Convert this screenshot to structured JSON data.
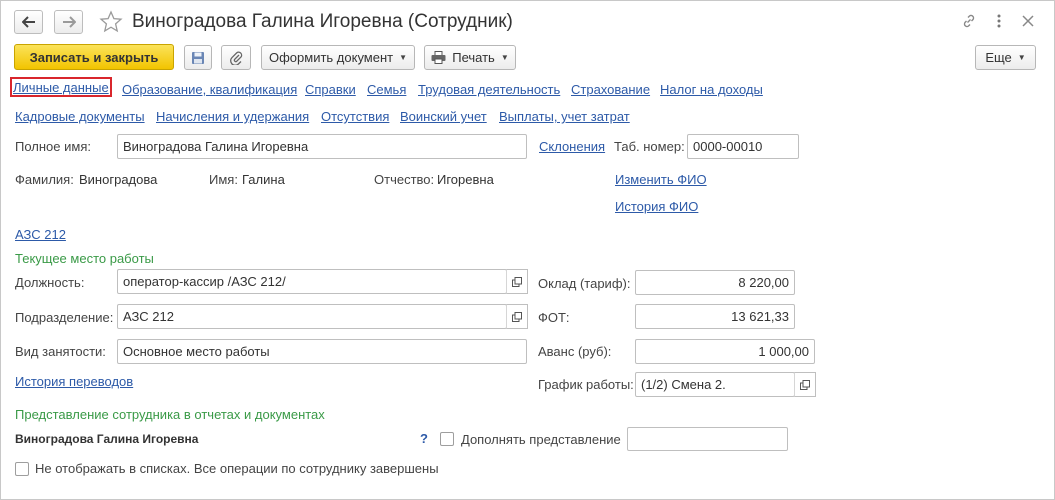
{
  "window": {
    "title": "Виноградова Галина Игоревна (Сотрудник)",
    "icons": [
      "arrow-left-icon",
      "arrow-right-icon",
      "star-icon",
      "link-icon",
      "more-vertical-icon",
      "close-icon"
    ]
  },
  "toolbar": {
    "save_close_label": "Записать и закрыть",
    "create_document_label": "Оформить документ",
    "print_label": "Печать",
    "more_label": "Еще"
  },
  "nav": {
    "row1": [
      "Личные данные",
      "Образование, квалификация",
      "Справки",
      "Семья",
      "Трудовая деятельность",
      "Страхование",
      "Налог на доходы"
    ],
    "row2": [
      "Кадровые документы",
      "Начисления и удержания",
      "Отсутствия",
      "Воинский учет",
      "Выплаты, учет затрат"
    ],
    "active": "Личные данные"
  },
  "person": {
    "full_name_label": "Полное имя:",
    "full_name_value": "Виноградова Галина Игоревна",
    "declensions_link": "Склонения",
    "tab_number_label": "Таб. номер:",
    "tab_number_value": "0000-00010",
    "surname_label": "Фамилия:",
    "surname_value": "Виноградова",
    "name_label": "Имя:",
    "name_value": "Галина",
    "patronymic_label": "Отчество:",
    "patronymic_value": "Игоревна",
    "change_name_link": "Изменить ФИО",
    "name_history_link": "История ФИО"
  },
  "organization": {
    "link": "АЗС 212"
  },
  "workplace": {
    "section_title": "Текущее место работы",
    "position_label": "Должность:",
    "position_value": "оператор-кассир /АЗС 212/",
    "department_label": "Подразделение:",
    "department_value": "АЗС 212",
    "employment_label": "Вид занятости:",
    "employment_value": "Основное место работы",
    "transfer_history_link": "История переводов",
    "salary_label": "Оклад (тариф):",
    "salary_value": "8 220,00",
    "fot_label": "ФОТ:",
    "fot_value": "13 621,33",
    "advance_label": "Аванс (руб):",
    "advance_value": "1 000,00",
    "schedule_label": "График работы:",
    "schedule_value": "(1/2)  Смена 2."
  },
  "representation": {
    "section_title": "Представление сотрудника в отчетах и документах",
    "value": "Виноградова Галина Игоревна",
    "help": "?",
    "supplement_label": "Дополнять представление",
    "supplement_checked": false,
    "supplement_value": ""
  },
  "footer": {
    "hide_label": "Не отображать в списках. Все операции по сотруднику завершены",
    "hide_checked": false
  },
  "colors": {
    "primary_button": "#f2c400",
    "link": "#2d5aa8",
    "section_title": "#3a9a47",
    "active_tab_border": "#d9262c"
  }
}
